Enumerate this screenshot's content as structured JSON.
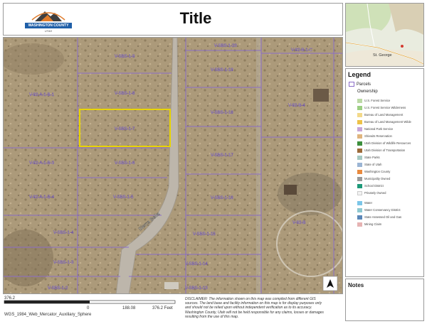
{
  "header": {
    "logo_text": "WASHINGTON COUNTY",
    "logo_sub": "UTAH",
    "title": "Title"
  },
  "map": {
    "parcel_labels": [
      "V-SBS-1-9",
      "V-SBS-1-20",
      "V-92-B-1-C",
      "V-92-A-1-B-1",
      "V-SBS-1-8",
      "V-SBS-1-19",
      "V-SBS-1-7",
      "V-SBS-1-18",
      "V-92-B-4",
      "V-92-A-1-B-3",
      "V-SBS-1-6",
      "V-SBS-1-17",
      "V-92-A-1-B-4",
      "V-SBS-1-5",
      "V-SBS-1-16",
      "V-SBS-1-4",
      "V-SBS-1-15",
      "V-92-B",
      "V-SBS-1-3",
      "V-SBS-1-14",
      "V-SBS-1-2",
      "V-SBS-1-13"
    ],
    "street_label": "Sierra Bella",
    "north_arrow_icon": "north-arrow-icon",
    "selected_parcel": "V-SBS-1-7",
    "colors": {
      "parcel_line": "#8a6dc8",
      "selected": "#e8d400",
      "road": "#b9b2a8",
      "terrain": "#a99677"
    }
  },
  "scale": {
    "left_label": "376.2",
    "zero_label": "0",
    "mid_label": "188.08",
    "right_label": "376.2 Feet",
    "disclaimer": "DISCLAIMER: The information shown on this map was compiled from different GIS sources. The land base and facility information on this map is for display purposes only and should not be relied upon without independent verification as to its accuracy. Washington County, Utah will not be held responsible for any claims, losses or damages resulting from the use of this map.",
    "srs": "WGS_1984_Web_Mercator_Auxiliary_Sphere"
  },
  "inset": {
    "city_label": "St. George"
  },
  "legend": {
    "title": "Legend",
    "parcels_label": "Parcels",
    "ownership_label": "Ownership",
    "items": [
      {
        "label": "U.S. Forest Service",
        "color": "#bcd9a6"
      },
      {
        "label": "U.S. Forest Service Wilderness",
        "color": "#9ccf83"
      },
      {
        "label": "Bureau of Land Management",
        "color": "#f3d98a"
      },
      {
        "label": "Bureau of Land Management Wilde",
        "color": "#eec248"
      },
      {
        "label": "National Park Service",
        "color": "#c7a6d8"
      },
      {
        "label": "Shivwits Reservation",
        "color": "#e0b57e"
      },
      {
        "label": "Utah Division of Wildlife Resources",
        "color": "#3d8f3d"
      },
      {
        "label": "Utah Division of Transportation",
        "color": "#9c6b3a"
      },
      {
        "label": "State Parks",
        "color": "#a5c9c2"
      },
      {
        "label": "State of Utah",
        "color": "#9bb5d4"
      },
      {
        "label": "Washington County",
        "color": "#e98a3f"
      },
      {
        "label": "Municipality Owned",
        "color": "#9a9a9a"
      },
      {
        "label": "School District",
        "color": "#1e9a7a"
      },
      {
        "label": "Privately Owned",
        "color": "#f2f2f2"
      },
      {
        "label": "Water",
        "color": "#7cc6e8"
      },
      {
        "label": "Water Conservancy District",
        "color": "#8ec8d0"
      },
      {
        "label": "State Assessed Oil and Gas",
        "color": "#5b87b8"
      },
      {
        "label": "Mining Claim",
        "color": "#e6b3b3"
      }
    ]
  },
  "notes": {
    "title": "Notes"
  }
}
